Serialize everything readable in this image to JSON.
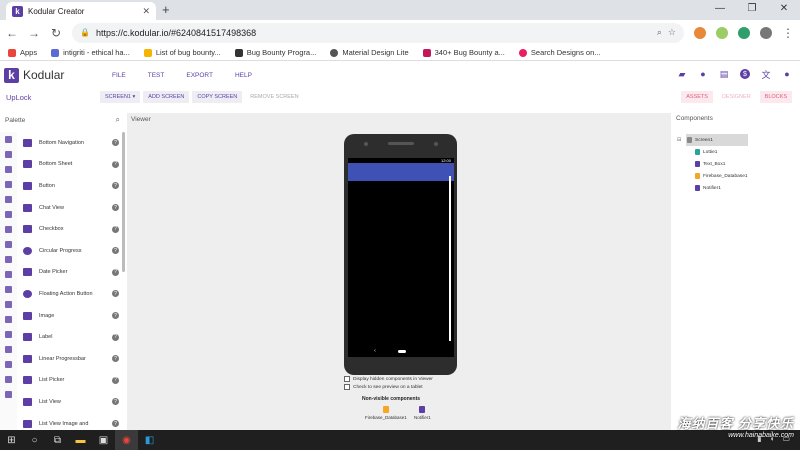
{
  "browser": {
    "tab_title": "Kodular Creator",
    "url": "https://c.kodular.io/#6240841517498368",
    "bookmarks": [
      {
        "label": "Apps",
        "color": "#e8453c"
      },
      {
        "label": "intigriti - ethical ha...",
        "color": "#5b6bd6"
      },
      {
        "label": "List of bug bounty...",
        "color": "#f4b400"
      },
      {
        "label": "Bug Bounty Progra...",
        "color": "#333333"
      },
      {
        "label": "Material Design Lite",
        "color": "#555555"
      },
      {
        "label": "340+ Bug Bounty a...",
        "color": "#c2185b"
      },
      {
        "label": "Search Designs on...",
        "color": "#e91e63"
      }
    ]
  },
  "header": {
    "logo_text": "Kodular",
    "menu": [
      "FILE",
      "TEST",
      "EXPORT",
      "HELP"
    ]
  },
  "subbar": {
    "project_name": "UpLock",
    "screen_select": "SCREEN1 ▾",
    "add_screen": "ADD SCREEN",
    "copy_screen": "COPY SCREEN",
    "remove_screen": "REMOVE SCREEN",
    "assets": "ASSETS",
    "designer": "DESIGNER",
    "blocks": "BLOCKS"
  },
  "palette": {
    "title": "Palette",
    "items": [
      "Bottom Navigation",
      "Bottom Sheet",
      "Button",
      "Chat View",
      "Checkbox",
      "Circular Progress",
      "Date Picker",
      "Floating Action Button",
      "Image",
      "Label",
      "Linear Progressbar",
      "List Picker",
      "List View",
      "List View Image and"
    ]
  },
  "viewer": {
    "title": "Viewer",
    "time": "12:00",
    "display_hidden": "Display hidden components in Viewer",
    "tablet_preview": "Check to see preview on a tablet",
    "nonvisible_title": "Non-visible components",
    "nonvisible": [
      {
        "label": "Firebase_Database1",
        "color": "#f5a623"
      },
      {
        "label": "Notifier1",
        "color": "#5c3ea5"
      }
    ],
    "appbar_color": "#3f51b5"
  },
  "components": {
    "title": "Components",
    "root": "Screen1",
    "children": [
      {
        "label": "Lottie1",
        "color": "#26a69a"
      },
      {
        "label": "Text_Box1",
        "color": "#5c3ea5"
      },
      {
        "label": "Firebase_Database1",
        "color": "#f5a623"
      },
      {
        "label": "Notifier1",
        "color": "#5c3ea5"
      }
    ]
  },
  "watermark": {
    "line1": "海纳百客 分享快乐",
    "line2": "www.hainabaike.com"
  },
  "colors": {
    "accent": "#5c3ea5",
    "view_tab": "#e25b7a"
  }
}
